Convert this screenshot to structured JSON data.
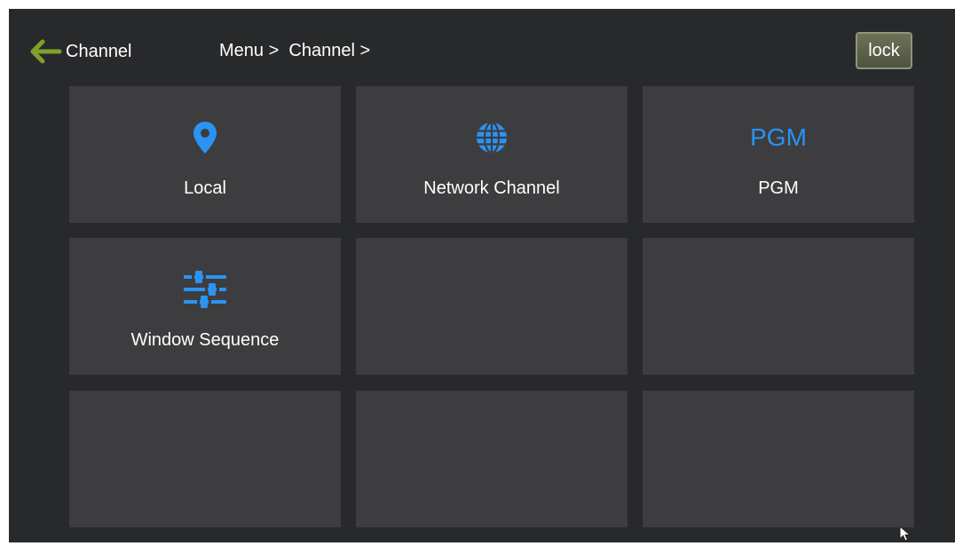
{
  "header": {
    "back_label": "Channel",
    "breadcrumb": "Menu >  Channel >",
    "lock_label": "lock"
  },
  "tiles": [
    {
      "label": "Local",
      "icon": "location-pin-icon"
    },
    {
      "label": "Network Channel",
      "icon": "globe-icon"
    },
    {
      "label": "PGM",
      "icon": "pgm-icon",
      "icon_text": "PGM"
    },
    {
      "label": "Window Sequence",
      "icon": "sliders-icon"
    },
    {
      "label": ""
    },
    {
      "label": ""
    },
    {
      "label": ""
    },
    {
      "label": ""
    },
    {
      "label": ""
    }
  ],
  "colors": {
    "background": "#28292b",
    "tile": "#3d3d3f",
    "accent": "#2a93f4",
    "back_arrow": "#7da12b",
    "lock_button": "#5c6148"
  }
}
